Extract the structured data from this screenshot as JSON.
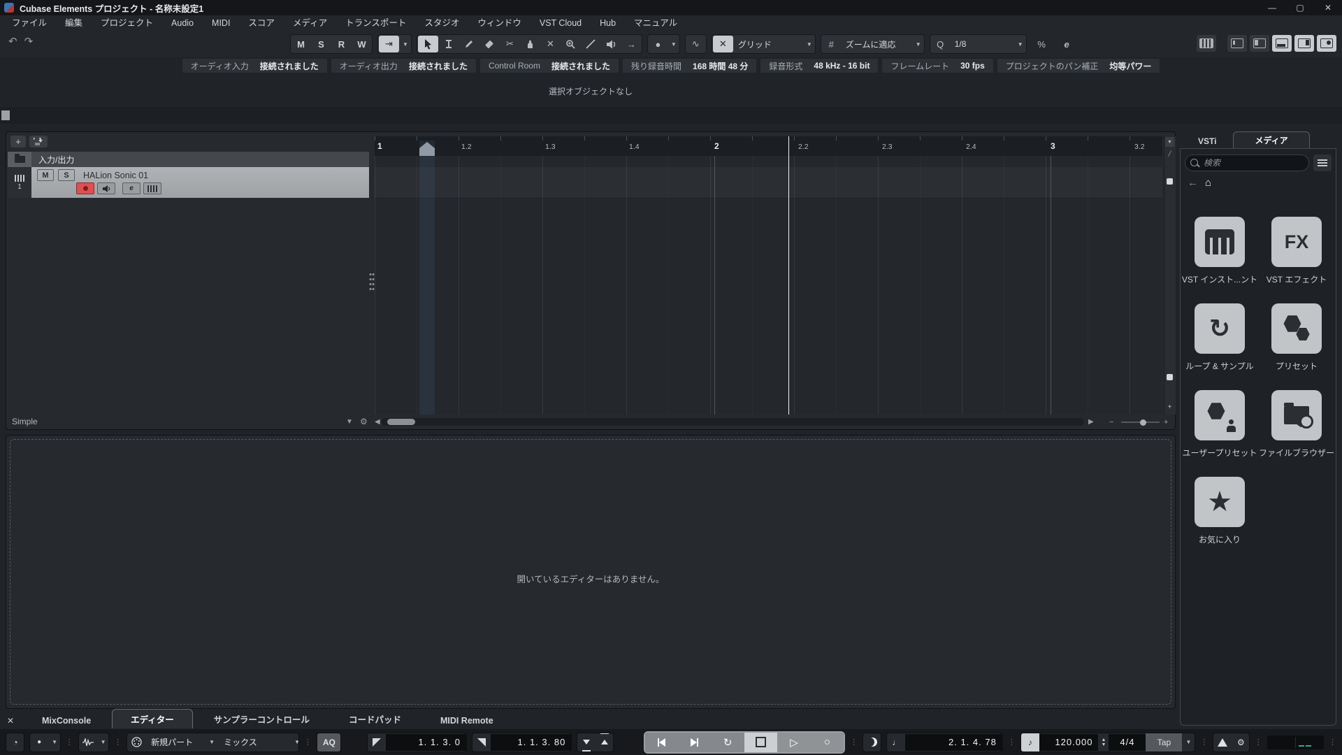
{
  "window": {
    "title": "Cubase Elements プロジェクト - 名称未設定1",
    "minimize": "—",
    "maximize": "▢",
    "close": "✕"
  },
  "menu": {
    "items": [
      "ファイル",
      "編集",
      "プロジェクト",
      "Audio",
      "MIDI",
      "スコア",
      "メディア",
      "トランスポート",
      "スタジオ",
      "ウィンドウ",
      "VST Cloud",
      "Hub",
      "マニュアル"
    ]
  },
  "toolbar": {
    "m": "M",
    "s": "S",
    "r": "R",
    "w": "W",
    "snap_mode": "グリッド",
    "zoom_mode": "ズームに適応",
    "q": "Q",
    "quantize": "1/8",
    "percent": "%",
    "e": "e"
  },
  "info_bar": {
    "items": [
      {
        "label": "オーディオ入力",
        "value": "接続されました"
      },
      {
        "label": "オーディオ出力",
        "value": "接続されました"
      },
      {
        "label": "Control Room",
        "value": "接続されました"
      },
      {
        "label": "残り録音時間",
        "value": "168 時間 48 分"
      },
      {
        "label": "録音形式",
        "value": "48 kHz - 16 bit"
      },
      {
        "label": "フレームレート",
        "value": "30 fps"
      },
      {
        "label": "プロジェクトのパン補正",
        "value": "均等パワー"
      }
    ]
  },
  "status_line": "選択オブジェクトなし",
  "track_area": {
    "io_label": "入力/出力",
    "track_number": "1",
    "track_name": "HALion Sonic 01",
    "mute": "M",
    "solo": "S",
    "edit": "e"
  },
  "timeline": {
    "ticks": [
      "1",
      "1.2",
      "1.3",
      "1.4",
      "2",
      "2.2",
      "2.3",
      "2.4",
      "3",
      "3.2"
    ]
  },
  "workspace_footer": {
    "preset": "Simple"
  },
  "lower_zone": {
    "message": "開いているエディターはありません。"
  },
  "bottom_tabs": {
    "items": [
      "MixConsole",
      "エディター",
      "サンプラーコントロール",
      "コードパッド",
      "MIDI Remote"
    ]
  },
  "right_panel": {
    "tab_vsti": "VSTi",
    "tab_media": "メディア",
    "search_placeholder": "検索",
    "fx": "FX",
    "tiles": [
      {
        "label": "VST インスト...ント"
      },
      {
        "label": "VST エフェクト"
      },
      {
        "label": "ループ & サンプル"
      },
      {
        "label": "プリセット"
      },
      {
        "label": "ユーザープリセット"
      },
      {
        "label": "ファイルブラウザー"
      },
      {
        "label": "お気に入り"
      }
    ]
  },
  "transport": {
    "record_part": "新規パート",
    "midi_mix": "ミックス",
    "aq": "AQ",
    "left_locator": "1. 1. 3. 0",
    "right_locator": "1. 1. 3. 80",
    "position": "2. 1. 4. 78",
    "tempo": "120.000",
    "time_signature": "4/4",
    "tap": "Tap"
  },
  "colors": {
    "record_red": "#e04f4f",
    "selection_light": "#c9cccf",
    "meter_teal": "#2fa8a2"
  }
}
